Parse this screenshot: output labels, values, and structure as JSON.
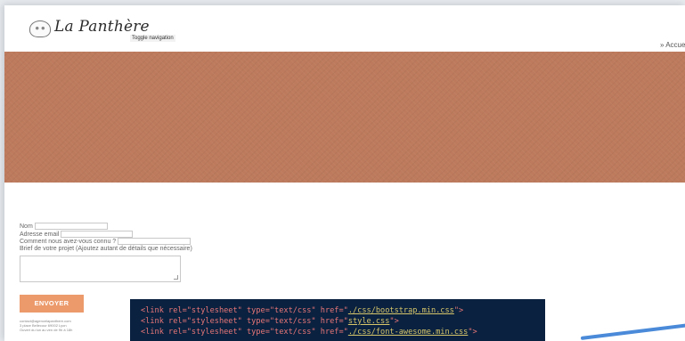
{
  "navbar": {
    "brand": "La Panthère",
    "toggle_label": "Toggle navigation",
    "links": [
      "Accueil"
    ]
  },
  "hero": {
    "color": "#bd7a5c"
  },
  "form": {
    "name_label": "Nom",
    "email_label": "Adresse email",
    "source_label": "Comment nous avez-vous connu ?",
    "brief_label": "Brief de votre projet (Ajoutez autant de détails que nécessaire)",
    "submit_label": "ENVOYER",
    "accent_color": "#ec9a6c"
  },
  "contact": {
    "line1": "contact@agencelapanthere.com",
    "line2": "3 place Bellecour 69002 Lyon",
    "line3": "Ouvert du lun au ven de 9h à 18h"
  },
  "code": {
    "lines": [
      {
        "pre": "<link rel=\"stylesheet\" type=\"text/css\" href=\"",
        "href": "./css/bootstrap.min.css",
        "post": "\">"
      },
      {
        "pre": "<link rel=\"stylesheet\" type=\"text/css\" href=\"",
        "href": "style.css",
        "post": "\">"
      },
      {
        "pre": "<link rel=\"stylesheet\" type=\"text/css\" href=\"",
        "href": "./css/font-awesome.min.css",
        "post": "\">"
      }
    ]
  }
}
